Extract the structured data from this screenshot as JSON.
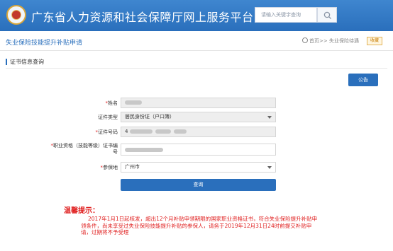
{
  "header": {
    "site_title": "广东省人力资源和社会保障厅网上服务平台",
    "search_placeholder": "请输入关键字查询",
    "icons": {
      "logo": "emblem-logo",
      "search": "search-icon"
    }
  },
  "page": {
    "title": "失业保险技能提升补贴申请",
    "breadcrumb": "首页>> 失业保险待遇",
    "collect_label": "收藏"
  },
  "section": {
    "title": "证书信息查询",
    "notice_button": "公告"
  },
  "form": {
    "name_label": "姓名",
    "id_type_label": "证件类型",
    "id_type_value": "居民身份证（户口簿）",
    "id_number_label": "证件号码",
    "id_number_prefix": "4",
    "cert_label": "职业资格（技能等级）证书编号",
    "insured_label": "参保地",
    "insured_value": "广州市",
    "query_button": "查询"
  },
  "tips": {
    "title": "温馨提示：",
    "body": "2017年1月1日起核发，超出12个月补贴申领期限的国家职业资格证书，符合失业保险提升补贴申领条件，尚未享受过失业保险技能提升补贴的参保人，请务于2019年12月31日24时前提交补贴申请，过期将不予受理"
  },
  "colors": {
    "brand_blue": "#2a6fbc",
    "warning_red": "#e02020",
    "required_star": "#e02020"
  }
}
